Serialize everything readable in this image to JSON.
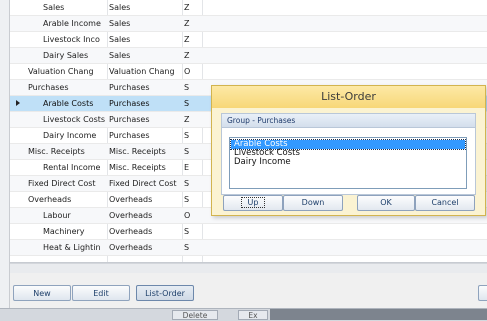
{
  "grid": {
    "rows": [
      {
        "name": "Sales",
        "group": "Sales",
        "code": "Z",
        "indent": true,
        "selected": false
      },
      {
        "name": "Arable Income",
        "group": "Sales",
        "code": "Z",
        "indent": true,
        "selected": false
      },
      {
        "name": "Livestock Inco",
        "group": "Sales",
        "code": "Z",
        "indent": true,
        "selected": false
      },
      {
        "name": "Dairy Sales",
        "group": "Sales",
        "code": "Z",
        "indent": true,
        "selected": false
      },
      {
        "name": "Valuation Chang",
        "group": "Valuation Chang",
        "code": "O",
        "indent": false,
        "selected": false
      },
      {
        "name": "Purchases",
        "group": "Purchases",
        "code": "S",
        "indent": false,
        "selected": false
      },
      {
        "name": "Arable Costs",
        "group": "Purchases",
        "code": "S",
        "indent": true,
        "selected": true
      },
      {
        "name": "Livestock Costs",
        "group": "Purchases",
        "code": "Z",
        "indent": true,
        "selected": false
      },
      {
        "name": "Dairy Income",
        "group": "Purchases",
        "code": "S",
        "indent": true,
        "selected": false
      },
      {
        "name": "Misc. Receipts",
        "group": "Misc. Receipts",
        "code": "S",
        "indent": false,
        "selected": false
      },
      {
        "name": "Rental Income",
        "group": "Misc. Receipts",
        "code": "E",
        "indent": true,
        "selected": false
      },
      {
        "name": "Fixed Direct Cost",
        "group": "Fixed Direct Cost",
        "code": "S",
        "indent": false,
        "selected": false
      },
      {
        "name": "Overheads",
        "group": "Overheads",
        "code": "S",
        "indent": false,
        "selected": false
      },
      {
        "name": "Labour",
        "group": "Overheads",
        "code": "O",
        "indent": true,
        "selected": false
      },
      {
        "name": "Machinery",
        "group": "Overheads",
        "code": "S",
        "indent": true,
        "selected": false
      },
      {
        "name": "Heat & Lightin",
        "group": "Overheads",
        "code": "S",
        "indent": true,
        "selected": false
      }
    ]
  },
  "toolbar": {
    "new_label": "New",
    "edit_label": "Edit",
    "list_order_label": "List-Order"
  },
  "statusbar": {
    "delete_label": "Delete",
    "ex_label": "Ex"
  },
  "dialog": {
    "title": "List-Order",
    "group_caption": "Group - Purchases",
    "items": [
      "Arable Costs",
      "Livestock Costs",
      "Dairy Income"
    ],
    "selected_index": 0,
    "buttons": {
      "up": "Up",
      "down": "Down",
      "ok": "OK",
      "cancel": "Cancel"
    }
  },
  "colors": {
    "selection_row": "#bfe0f7",
    "dialog_title": "#f7d778",
    "list_selection": "#3399ff"
  }
}
